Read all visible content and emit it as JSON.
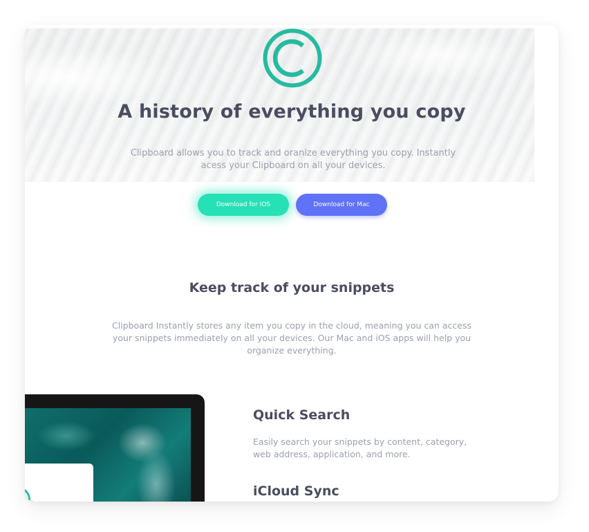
{
  "hero": {
    "logo_icon": "copyright-c-logo",
    "title": "A history of everything you copy",
    "description": "Clipboard allows you to track and oranize everything you copy. Instantly acess your Clipboard on all your devices.",
    "buttons": {
      "ios_label": "Download for IOS",
      "mac_label": "Download for Mac"
    }
  },
  "snippets": {
    "title": "Keep track of your snippets",
    "description": "Clipboard Instantly stores any item you copy in the cloud, meaning you can access your snippets immediately on all your devices. Our Mac and iOS apps will help you organize everything."
  },
  "features": [
    {
      "title": "Quick Search",
      "description": "Easily search your snippets by content, category, web address, application, and more."
    },
    {
      "title": "iCloud Sync",
      "description": ""
    }
  ],
  "colors": {
    "primary_teal": "#26e0b6",
    "primary_blue": "#6072f6",
    "heading": "#494d5f",
    "body_text": "#9b9fae"
  }
}
